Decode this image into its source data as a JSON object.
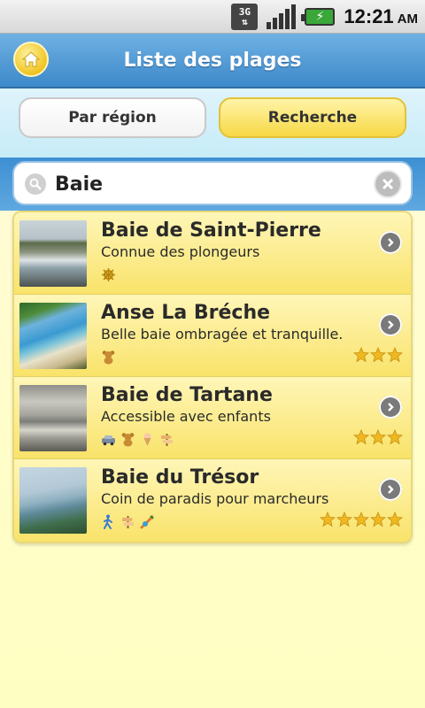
{
  "statusbar": {
    "network": "3G",
    "time": "12:21",
    "ampm": "AM"
  },
  "header": {
    "title": "Liste des plages"
  },
  "tabs": {
    "region_label": "Par région",
    "search_label": "Recherche"
  },
  "search": {
    "value": "Baie",
    "placeholder": ""
  },
  "beaches": [
    {
      "name": "Baie de Saint-Pierre",
      "description": "Connue des plongeurs",
      "amenities": [
        "helm-icon"
      ],
      "rating": 0
    },
    {
      "name": "Anse La Bréche",
      "description": "Belle baie ombragée et tranquille.",
      "amenities": [
        "teddy-bear-icon"
      ],
      "rating": 3
    },
    {
      "name": "Baie de Tartane",
      "description": "Accessible avec enfants",
      "amenities": [
        "car-icon",
        "teddy-bear-icon",
        "ice-cream-icon",
        "signpost-icon"
      ],
      "rating": 3
    },
    {
      "name": "Baie du Trésor",
      "description": "Coin de paradis pour marcheurs",
      "amenities": [
        "hiker-icon",
        "signpost-icon",
        "snorkel-icon"
      ],
      "rating": 5
    }
  ],
  "colors": {
    "header_blue": "#3d89c9",
    "row_yellow": "#f9e36a",
    "star_gold": "#f0b820"
  }
}
